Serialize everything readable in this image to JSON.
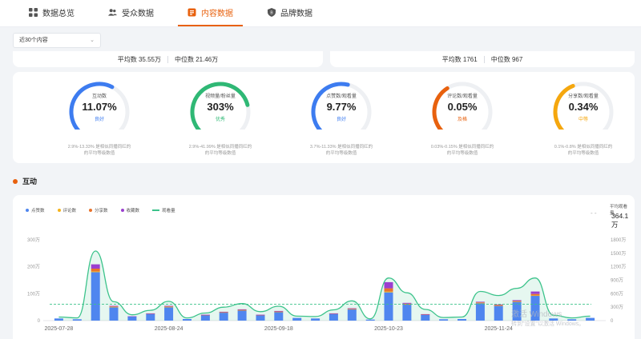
{
  "tabs": [
    {
      "label": "数据总览",
      "icon": "grid-icon",
      "active": false
    },
    {
      "label": "受众数据",
      "icon": "users-icon",
      "active": false
    },
    {
      "label": "内容数据",
      "icon": "content-icon",
      "active": true
    },
    {
      "label": "品牌数据",
      "icon": "shield-icon",
      "active": false
    }
  ],
  "filter": {
    "value": "近30个内容"
  },
  "summary_left": {
    "avg": "平均数 35.55万",
    "median": "中位数 21.46万"
  },
  "summary_right": {
    "avg": "平均数 1761",
    "median": "中位数 967"
  },
  "metrics": [
    {
      "label": "互动数",
      "value": "11.07%",
      "level": "良好",
      "color": "#3d7cf0",
      "pct": 0.6,
      "desc": [
        "2.9%-13.33% 是相似同播同红的",
        "的平均等级数值"
      ]
    },
    {
      "label": "视频量/粉丝量",
      "value": "303%",
      "level": "优秀",
      "color": "#2fb875",
      "pct": 0.78,
      "desc": [
        "2.9%-41.99% 是相似同播同红的",
        "的平均等级数值"
      ]
    },
    {
      "label": "点赞数/观看量",
      "value": "9.77%",
      "level": "良好",
      "color": "#3d7cf0",
      "pct": 0.55,
      "desc": [
        "3.7%-11.33% 是相似同播同红的",
        "的平均等级数值"
      ]
    },
    {
      "label": "评论数/观看量",
      "value": "0.05%",
      "level": "及格",
      "color": "#e8610e",
      "pct": 0.38,
      "desc": [
        "0.03%-0.15% 是相似同播同红的",
        "的平均等级数值"
      ]
    },
    {
      "label": "分享数/观看量",
      "value": "0.34%",
      "level": "中等",
      "color": "#f5a70e",
      "pct": 0.42,
      "desc": [
        "0.1%-0.8% 是相似同播同红的",
        "的平均等级数值"
      ]
    }
  ],
  "section": {
    "title": "互动"
  },
  "avg_views": {
    "dash": "- -",
    "label": "平均观看量",
    "value": "364.1万"
  },
  "watermark": {
    "line1": "激活 Windows",
    "line2": "转到\"设置\"以激活 Windows。"
  },
  "chart_data": {
    "type": "bar",
    "legend": [
      {
        "name": "点赞数",
        "color": "#4f86ef",
        "kind": "dot"
      },
      {
        "name": "评论数",
        "color": "#f5b31a",
        "kind": "dot"
      },
      {
        "name": "分享数",
        "color": "#e8732b",
        "kind": "dot"
      },
      {
        "name": "收藏数",
        "color": "#9b3fcf",
        "kind": "dot"
      },
      {
        "name": "观看量",
        "color": "#3cc38b",
        "kind": "line"
      }
    ],
    "x_tick_labels": [
      "2025-07-28",
      "2025-08-24",
      "2025-09-18",
      "2025-10-23",
      "2025-11-24"
    ],
    "x_tick_positions": [
      0,
      6,
      12,
      18,
      24
    ],
    "y_left": {
      "ticks": [
        0,
        100,
        200,
        300
      ],
      "tick_labels": [
        "0",
        "100万",
        "200万",
        "300万"
      ],
      "max": 300
    },
    "y_right": {
      "ticks": [
        0,
        300,
        600,
        900,
        1200,
        1500,
        1800
      ],
      "tick_labels": [
        "0",
        "300万",
        "600万",
        "900万",
        "1200万",
        "1500万",
        "1800万"
      ],
      "max": 1800
    },
    "series": [
      {
        "name": "点赞数",
        "values": [
          8,
          5,
          180,
          50,
          15,
          25,
          50,
          6,
          20,
          30,
          38,
          20,
          32,
          10,
          8,
          25,
          42,
          4,
          105,
          60,
          22,
          5,
          6,
          65,
          55,
          70,
          92,
          8,
          5,
          10
        ]
      },
      {
        "name": "评论数",
        "values": [
          0,
          0,
          3,
          1,
          0,
          0,
          1,
          0,
          0,
          1,
          1,
          0,
          1,
          0,
          0,
          0,
          1,
          0,
          3,
          1,
          0,
          0,
          0,
          1,
          1,
          1,
          2,
          0,
          0,
          0
        ]
      },
      {
        "name": "分享数",
        "values": [
          0,
          0,
          10,
          2,
          0,
          1,
          2,
          0,
          1,
          1,
          1,
          1,
          1,
          0,
          0,
          1,
          1,
          0,
          12,
          2,
          1,
          0,
          0,
          2,
          2,
          2,
          5,
          0,
          0,
          0
        ]
      },
      {
        "name": "收藏数",
        "values": [
          0,
          0,
          16,
          2,
          1,
          1,
          2,
          0,
          1,
          1,
          2,
          1,
          2,
          0,
          0,
          1,
          2,
          0,
          23,
          3,
          1,
          0,
          0,
          2,
          2,
          3,
          9,
          0,
          0,
          0
        ]
      },
      {
        "name": "观看量",
        "axis": "right",
        "values": [
          80,
          60,
          1550,
          420,
          130,
          230,
          430,
          60,
          170,
          300,
          380,
          200,
          320,
          100,
          90,
          240,
          440,
          40,
          950,
          620,
          250,
          70,
          80,
          650,
          560,
          720,
          950,
          120,
          60,
          100
        ]
      }
    ],
    "average_line": {
      "series": "观看量",
      "value": 364.1,
      "axis": "right"
    }
  }
}
